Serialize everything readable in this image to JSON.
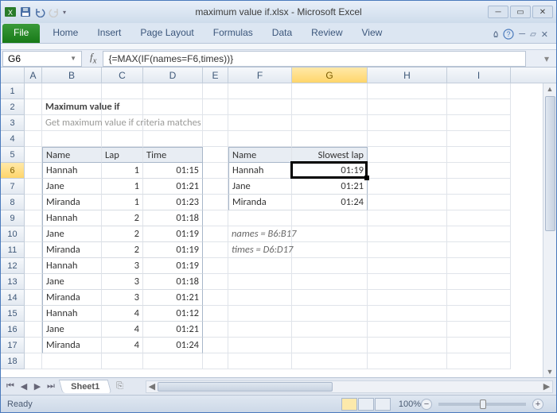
{
  "title": "maximum value if.xlsx  -  Microsoft Excel",
  "ribbon": {
    "file": "File",
    "tabs": [
      "Home",
      "Insert",
      "Page Layout",
      "Formulas",
      "Data",
      "Review",
      "View"
    ]
  },
  "namebox": "G6",
  "formula": "{=MAX(IF(names=F6,times))}",
  "columns": [
    "A",
    "B",
    "C",
    "D",
    "E",
    "F",
    "G",
    "H",
    "I"
  ],
  "selected": {
    "col": "G",
    "row": 6
  },
  "content": {
    "title": "Maximum value if",
    "subtitle": "Get maximum value if criteria matches",
    "table1": {
      "headers": [
        "Name",
        "Lap",
        "Time"
      ],
      "rows": [
        [
          "Hannah",
          "1",
          "01:15"
        ],
        [
          "Jane",
          "1",
          "01:21"
        ],
        [
          "Miranda",
          "1",
          "01:23"
        ],
        [
          "Hannah",
          "2",
          "01:18"
        ],
        [
          "Jane",
          "2",
          "01:19"
        ],
        [
          "Miranda",
          "2",
          "01:19"
        ],
        [
          "Hannah",
          "3",
          "01:19"
        ],
        [
          "Jane",
          "3",
          "01:18"
        ],
        [
          "Miranda",
          "3",
          "01:21"
        ],
        [
          "Hannah",
          "4",
          "01:12"
        ],
        [
          "Jane",
          "4",
          "01:21"
        ],
        [
          "Miranda",
          "4",
          "01:24"
        ]
      ]
    },
    "table2": {
      "headers": [
        "Name",
        "Slowest lap"
      ],
      "rows": [
        [
          "Hannah",
          "01:19"
        ],
        [
          "Jane",
          "01:21"
        ],
        [
          "Miranda",
          "01:24"
        ]
      ]
    },
    "notes": [
      "names = B6:B17",
      "times = D6:D17"
    ]
  },
  "sheet": "Sheet1",
  "status": "Ready",
  "zoom": "100%"
}
